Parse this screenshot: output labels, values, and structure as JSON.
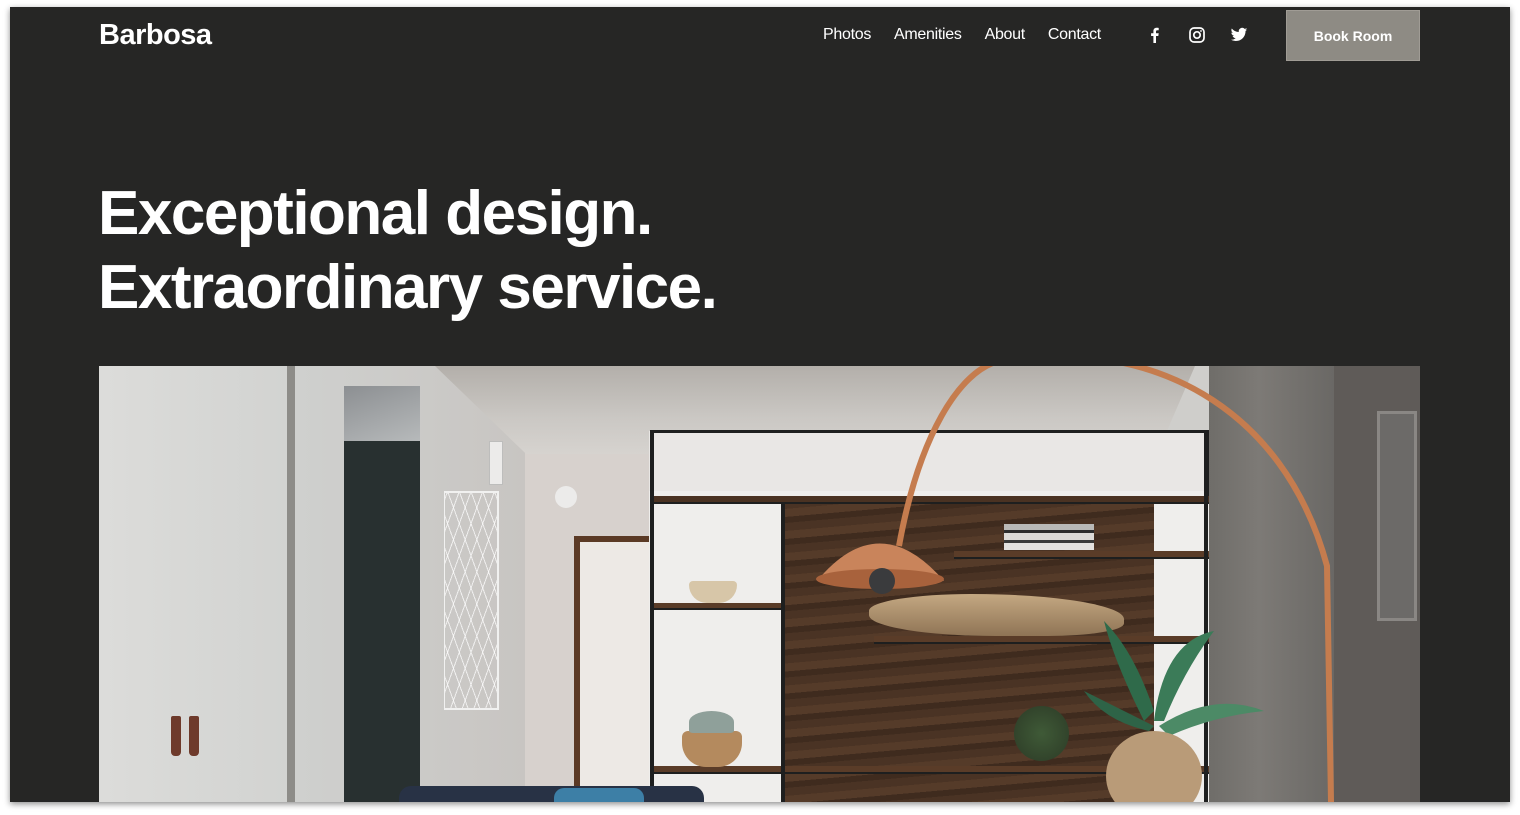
{
  "header": {
    "logo": "Barbosa",
    "nav": [
      {
        "label": "Photos"
      },
      {
        "label": "Amenities"
      },
      {
        "label": "About"
      },
      {
        "label": "Contact"
      }
    ],
    "social": [
      {
        "icon": "facebook-icon"
      },
      {
        "icon": "instagram-icon"
      },
      {
        "icon": "twitter-icon"
      }
    ],
    "cta": "Book Room"
  },
  "hero": {
    "line1": "Exceptional design.",
    "line2": "Extraordinary service."
  },
  "photo": {
    "description": "Modern hotel room interior with copper arc lamp, walnut shelving, plants"
  },
  "colors": {
    "background": "#262625",
    "button": "#8e8b84",
    "text": "#ffffff"
  }
}
